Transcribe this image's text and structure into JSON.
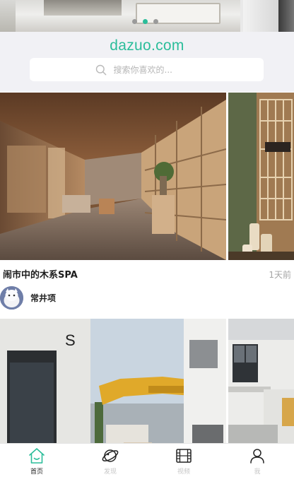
{
  "banner": {
    "dots": 3,
    "active_dot": 2
  },
  "brand": {
    "name": "dazuo.com",
    "color": "#2bbd9a"
  },
  "search": {
    "placeholder": "搜索你喜欢的..."
  },
  "feed": [
    {
      "title": "闹市中的木系SPA",
      "time": "1天前",
      "author": "常井项"
    },
    {
      "title": "",
      "time": "",
      "author": ""
    }
  ],
  "tabs": [
    {
      "label": "首页",
      "icon": "home-icon",
      "active": true
    },
    {
      "label": "发现",
      "icon": "planet-icon",
      "active": false
    },
    {
      "label": "视频",
      "icon": "film-icon",
      "active": false
    },
    {
      "label": "我",
      "icon": "person-icon",
      "active": false
    }
  ],
  "colors": {
    "accent": "#2bbd9a",
    "tab_inactive": "#c7c7c7",
    "header_bg": "#f1f1f5"
  }
}
